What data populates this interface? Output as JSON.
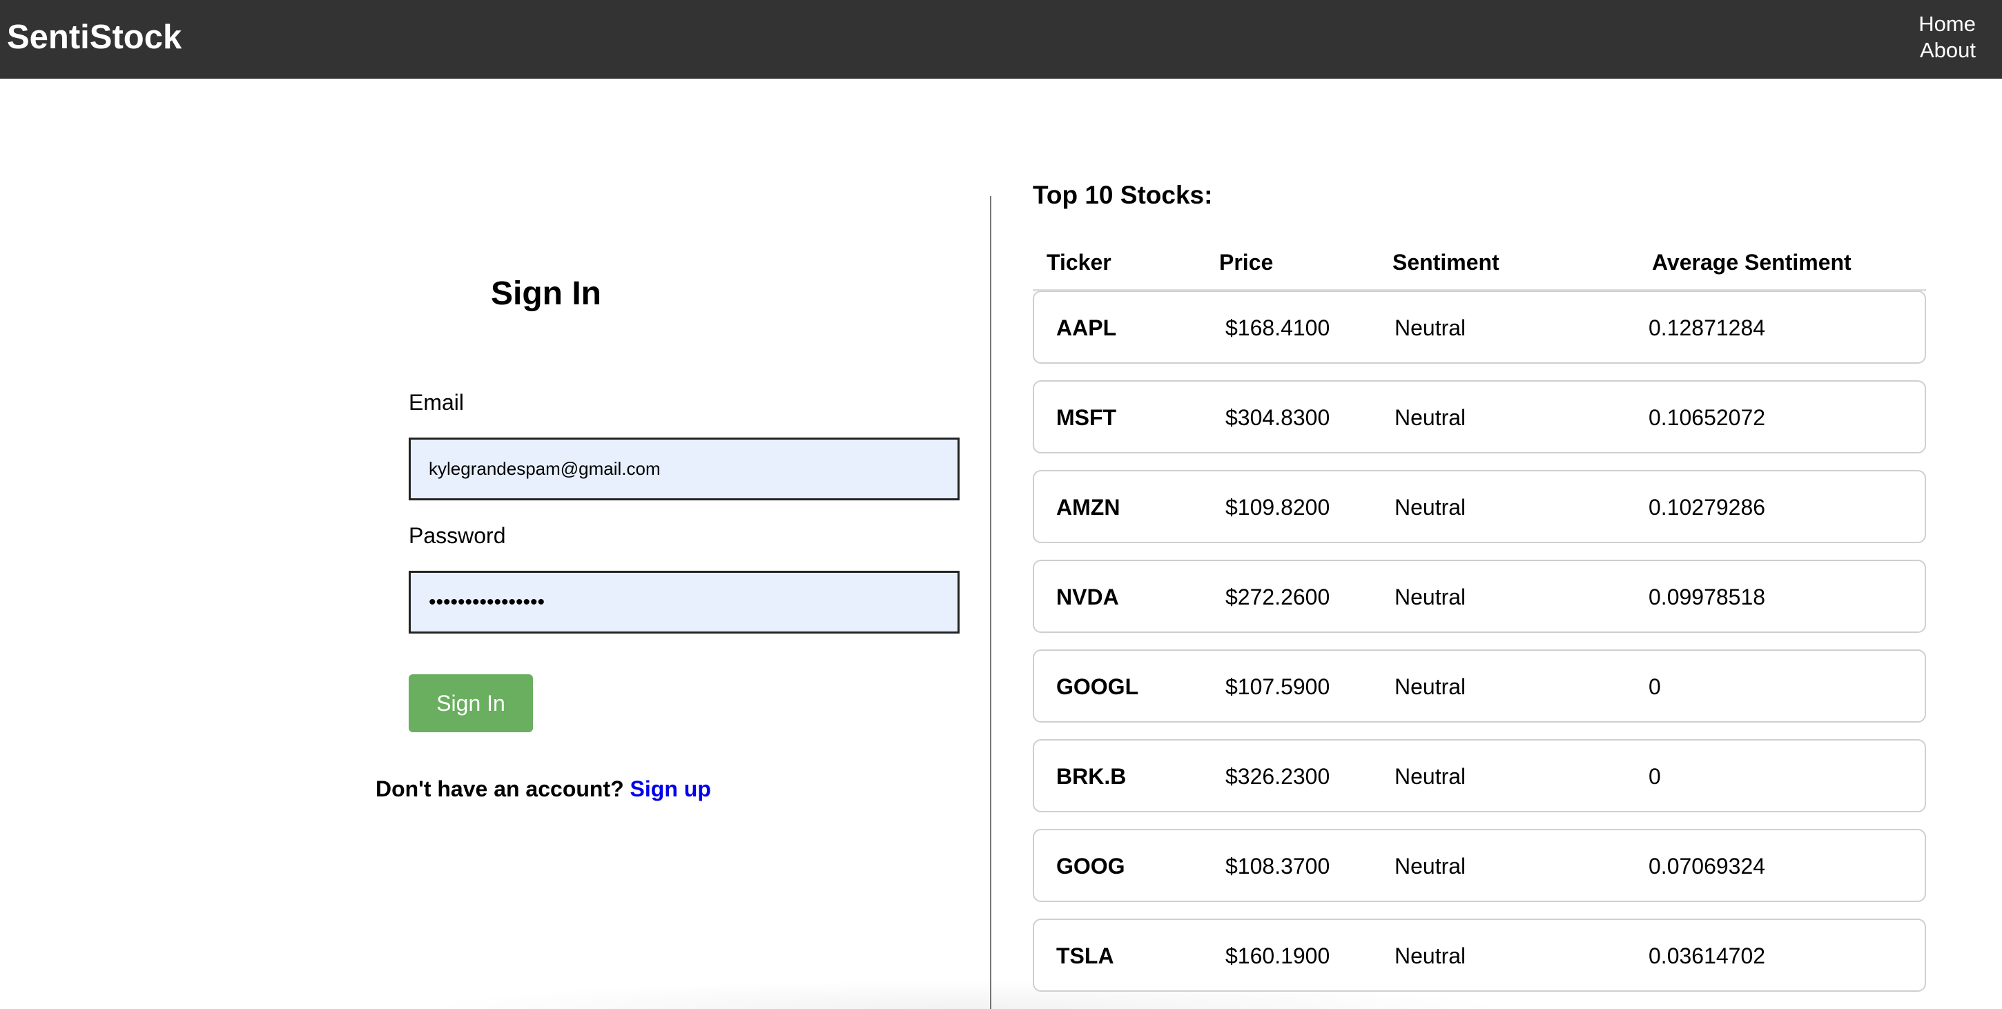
{
  "navbar": {
    "brand": "SentiStock",
    "links": [
      "Home",
      "About"
    ]
  },
  "signin": {
    "title": "Sign In",
    "email_label": "Email",
    "email_value": "kylegrandespam@gmail.com",
    "password_label": "Password",
    "password_value": "passwordpassword",
    "button_label": "Sign In",
    "signup_prompt": "Don't have an account?",
    "signup_link": "Sign up"
  },
  "stocks": {
    "title": "Top 10 Stocks:",
    "headers": [
      "Ticker",
      "Price",
      "Sentiment",
      "Average Sentiment"
    ],
    "rows": [
      {
        "ticker": "AAPL",
        "price": "$168.4100",
        "sentiment": "Neutral",
        "avg": "0.12871284"
      },
      {
        "ticker": "MSFT",
        "price": "$304.8300",
        "sentiment": "Neutral",
        "avg": "0.10652072"
      },
      {
        "ticker": "AMZN",
        "price": "$109.8200",
        "sentiment": "Neutral",
        "avg": "0.10279286"
      },
      {
        "ticker": "NVDA",
        "price": "$272.2600",
        "sentiment": "Neutral",
        "avg": "0.09978518"
      },
      {
        "ticker": "GOOGL",
        "price": "$107.5900",
        "sentiment": "Neutral",
        "avg": "0"
      },
      {
        "ticker": "BRK.B",
        "price": "$326.2300",
        "sentiment": "Neutral",
        "avg": "0"
      },
      {
        "ticker": "GOOG",
        "price": "$108.3700",
        "sentiment": "Neutral",
        "avg": "0.07069324"
      },
      {
        "ticker": "TSLA",
        "price": "$160.1900",
        "sentiment": "Neutral",
        "avg": "0.03614702"
      }
    ]
  },
  "colors": {
    "navbar": "#333333",
    "button": "#6aaf5f",
    "input_bg": "#e8f0fe",
    "link": "#0000ee"
  }
}
